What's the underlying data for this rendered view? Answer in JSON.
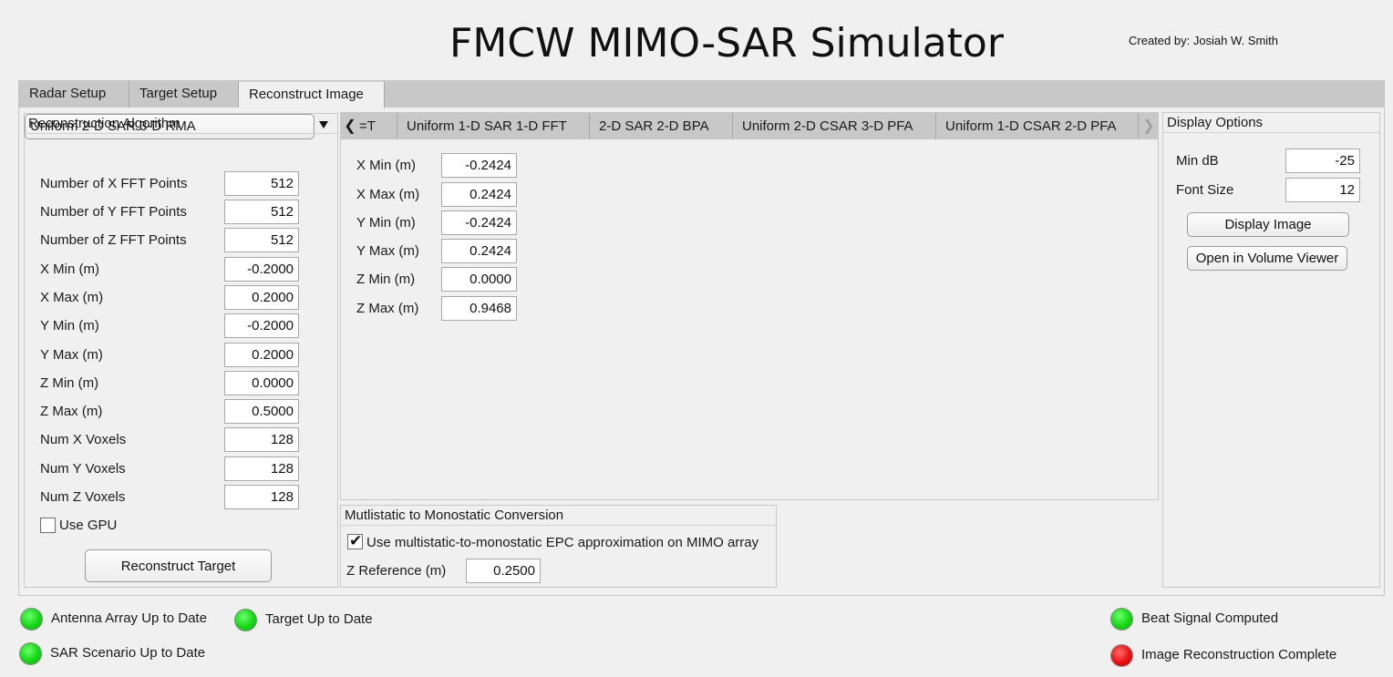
{
  "app": {
    "title": "FMCW MIMO-SAR Simulator",
    "credit": "Created by: Josiah W. Smith"
  },
  "tabs": [
    {
      "label": "Radar Setup",
      "active": false
    },
    {
      "label": "Target Setup",
      "active": false
    },
    {
      "label": "Reconstruct Image",
      "active": true
    }
  ],
  "reconstruction": {
    "title": "Reconstruction Algorithm",
    "algorithm": "Uniform 2-D SAR 3-D RMA",
    "fields": [
      {
        "label": "Number of X FFT Points",
        "value": "512"
      },
      {
        "label": "Number of Y FFT Points",
        "value": "512"
      },
      {
        "label": "Number of Z FFT Points",
        "value": "512"
      },
      {
        "label": "X Min (m)",
        "value": "-0.2000"
      },
      {
        "label": "X Max (m)",
        "value": "0.2000"
      },
      {
        "label": "Y Min (m)",
        "value": "-0.2000"
      },
      {
        "label": "Y Max (m)",
        "value": "0.2000"
      },
      {
        "label": "Z Min (m)",
        "value": "0.0000"
      },
      {
        "label": "Z Max (m)",
        "value": "0.5000"
      },
      {
        "label": "Num X Voxels",
        "value": "128"
      },
      {
        "label": "Num Y Voxels",
        "value": "128"
      },
      {
        "label": "Num Z Voxels",
        "value": "128"
      }
    ],
    "use_gpu_label": "Use GPU",
    "use_gpu_checked": false,
    "reconstruct_button": "Reconstruct Target"
  },
  "algo_tabs": {
    "partial_label": "=T",
    "labels": [
      "Uniform 1-D SAR 1-D FFT",
      "2-D SAR 2-D BPA",
      "Uniform 2-D CSAR 3-D PFA",
      "Uniform 1-D CSAR 2-D PFA"
    ],
    "fields": [
      {
        "label": "X Min (m)",
        "value": "-0.2424"
      },
      {
        "label": "X Max (m)",
        "value": "0.2424"
      },
      {
        "label": "Y Min (m)",
        "value": "-0.2424"
      },
      {
        "label": "Y Max (m)",
        "value": "0.2424"
      },
      {
        "label": "Z Min (m)",
        "value": "0.0000"
      },
      {
        "label": "Z Max (m)",
        "value": "0.9468"
      }
    ]
  },
  "multistatic": {
    "title": "Mutlistatic to Monostatic Conversion",
    "epc_label": "Use multistatic-to-monostatic EPC approximation on MIMO array",
    "epc_checked": true,
    "zref_label": "Z Reference (m)",
    "zref_value": "0.2500"
  },
  "display": {
    "title": "Display Options",
    "min_db_label": "Min dB",
    "min_db_value": "-25",
    "font_size_label": "Font Size",
    "font_size_value": "12",
    "display_button": "Display Image",
    "volume_button": "Open in Volume Viewer"
  },
  "status": [
    {
      "label": "Antenna Array Up to Date",
      "state": "green"
    },
    {
      "label": "Target Up to Date",
      "state": "green"
    },
    {
      "label": "SAR Scenario Up to Date",
      "state": "green"
    },
    {
      "label": "Beat Signal Computed",
      "state": "green"
    },
    {
      "label": "Image Reconstruction Complete",
      "state": "red"
    }
  ],
  "colors": {
    "background": "#f0f0f0",
    "tab_strip": "#c8c8c8",
    "lamp_green": "#13d813",
    "lamp_red": "#e81010"
  }
}
